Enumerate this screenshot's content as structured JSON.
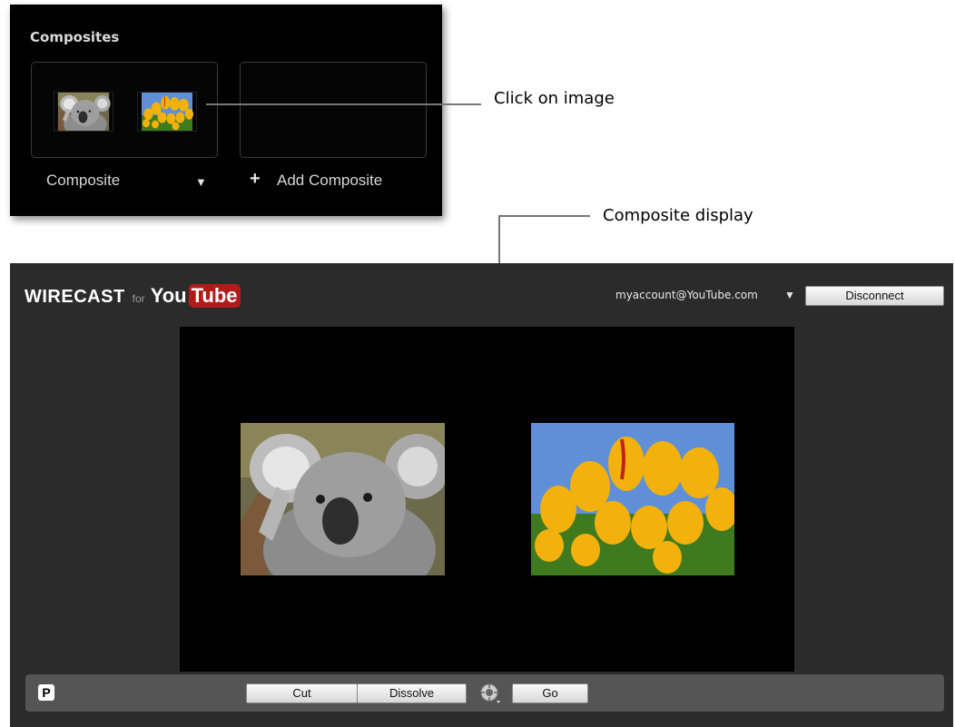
{
  "composites_panel": {
    "title": "Composites",
    "composite_label": "Composite",
    "caret": "▼",
    "add_plus": "+",
    "add_label": "Add Composite"
  },
  "callouts": {
    "click_image": "Click on image",
    "composite_display": "Composite display"
  },
  "app": {
    "brand_main": "WIRECAST",
    "brand_for": "for",
    "youtube_you": "You",
    "youtube_tube": "Tube",
    "account": "myaccount@YouTube.com",
    "account_caret": "▼",
    "disconnect_label": "Disconnect"
  },
  "controls": {
    "p_label": "P",
    "cut_label": "Cut",
    "dissolve_label": "Dissolve",
    "go_label": "Go"
  },
  "colors": {
    "panel_bg": "#000000",
    "window_bg": "#2b2b2b",
    "control_bar": "#555555",
    "youtube_red": "#b31b1b"
  },
  "icons": {
    "transition": "transition-icon",
    "caret": "chevron-down-icon",
    "plus": "plus-icon"
  }
}
